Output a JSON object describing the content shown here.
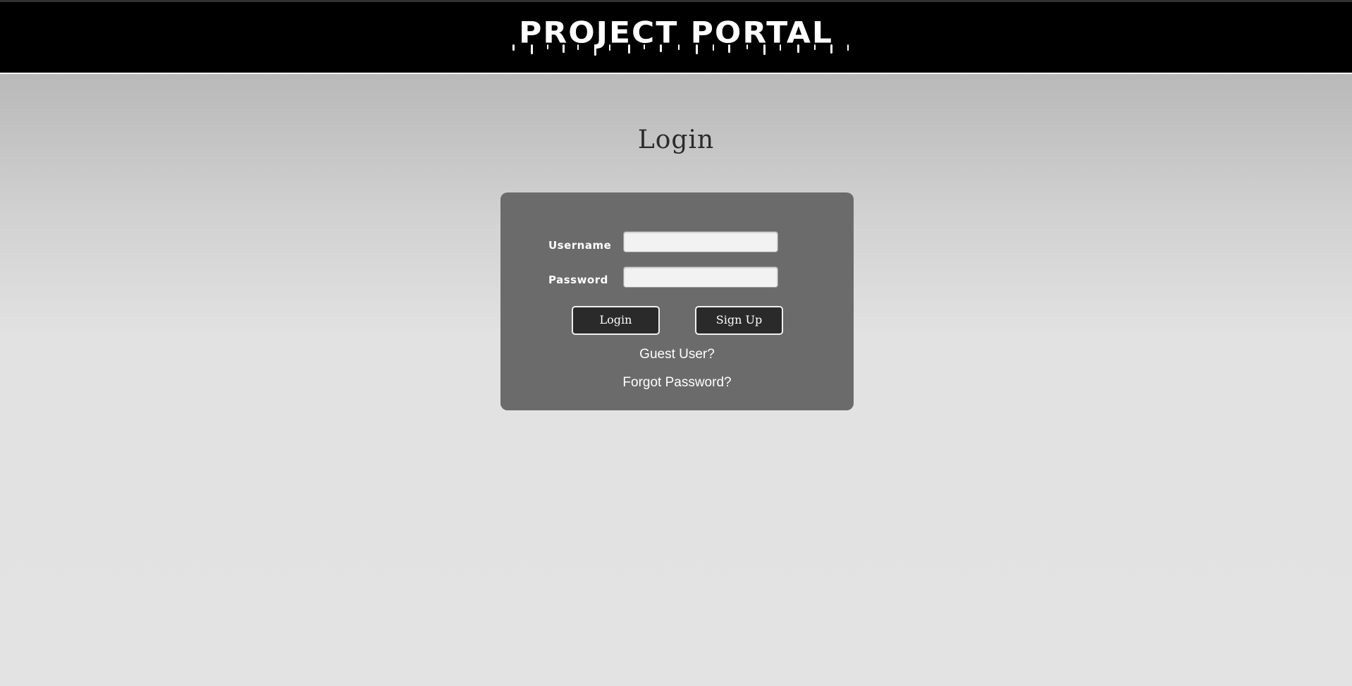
{
  "header": {
    "site_title": "PROJECT PORTAL"
  },
  "main": {
    "heading": "Login"
  },
  "login_form": {
    "username_label": "Username",
    "username_value": "",
    "password_label": "Password",
    "password_value": "",
    "login_button": "Login",
    "signup_button": "Sign Up",
    "guest_link": "Guest User?",
    "forgot_link": "Forgot Password?"
  },
  "colors": {
    "header_bg": "#000000",
    "card_bg": "#6b6b6b",
    "button_bg": "#2a2a2a",
    "text_light": "#ffffff",
    "heading_text": "#2b2b2b"
  }
}
